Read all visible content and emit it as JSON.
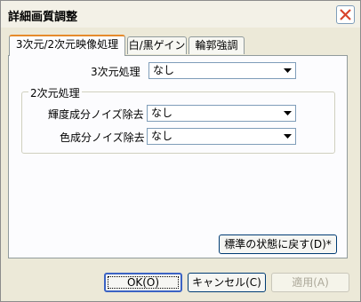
{
  "window": {
    "title": "詳細画質調整",
    "close_icon": "close-icon"
  },
  "tabs": [
    {
      "label": "3次元/2次元映像処理",
      "active": true
    },
    {
      "label": "白/黒ゲイン",
      "active": false
    },
    {
      "label": "輪郭強調",
      "active": false
    }
  ],
  "fields": {
    "three_d": {
      "label": "3次元処理",
      "value": "なし"
    },
    "group_title": "2次元処理",
    "luma_noise": {
      "label": "輝度成分ノイズ除去",
      "value": "なし"
    },
    "chroma_noise": {
      "label": "色成分ノイズ除去",
      "value": "なし"
    }
  },
  "buttons": {
    "restore_default": "標準の状態に戻す(D)*",
    "ok": "OK(O)",
    "cancel": "キャンセル(C)",
    "apply": "適用(A)"
  },
  "colors": {
    "tab_accent": "#e68b2c",
    "close_red": "#d8442c"
  }
}
